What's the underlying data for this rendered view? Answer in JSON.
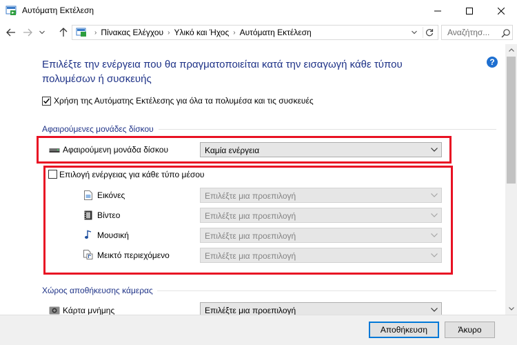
{
  "window": {
    "title": "Αυτόματη Εκτέλεση",
    "icon": "autoplay-control-panel-icon"
  },
  "address_bar": {
    "breadcrumbs": [
      "Πίνακας Ελέγχου",
      "Υλικό και Ήχος",
      "Αυτόματη Εκτέλεση"
    ],
    "search_placeholder": "Αναζήτησ..."
  },
  "main": {
    "heading": "Επιλέξτε την ενέργεια που θα πραγματοποιείται κατά την εισαγωγή κάθε τύπου πολυμέσων ή συσκευής",
    "use_autoplay": {
      "label": "Χρήση της Αυτόματης Εκτέλεσης για όλα τα πολυμέσα και τις συσκευές",
      "checked": true
    },
    "removable_drives": {
      "title": "Αφαιρούμενες μονάδες δίσκου",
      "drive_label": "Αφαιρούμενη μονάδα δίσκου",
      "drive_value": "Καμία ενέργεια",
      "per_media": {
        "label": "Επιλογή ενέργειας για κάθε τύπο μέσου",
        "checked": false
      },
      "media": [
        {
          "label": "Εικόνες",
          "value": "Επιλέξτε μια προεπιλογή",
          "icon": "picture-file-icon"
        },
        {
          "label": "Βίντεο",
          "value": "Επιλέξτε μια προεπιλογή",
          "icon": "video-file-icon"
        },
        {
          "label": "Μουσική",
          "value": "Επιλέξτε μια προεπιλογή",
          "icon": "music-note-icon"
        },
        {
          "label": "Μεικτό περιεχόμενο",
          "value": "Επιλέξτε μια προεπιλογή",
          "icon": "mixed-content-icon"
        }
      ]
    },
    "camera_storage": {
      "title": "Χώρος αποθήκευσης κάμερας",
      "memory_card_label": "Κάρτα μνήμης",
      "memory_card_value": "Επιλέξτε μια προεπιλογή"
    }
  },
  "footer": {
    "save_label": "Αποθήκευση",
    "cancel_label": "Άκυρο"
  },
  "colors": {
    "heading": "#1e3287",
    "highlight_box": "#e81123",
    "help": "#1e6fd0",
    "primary_border": "#0078d7"
  }
}
